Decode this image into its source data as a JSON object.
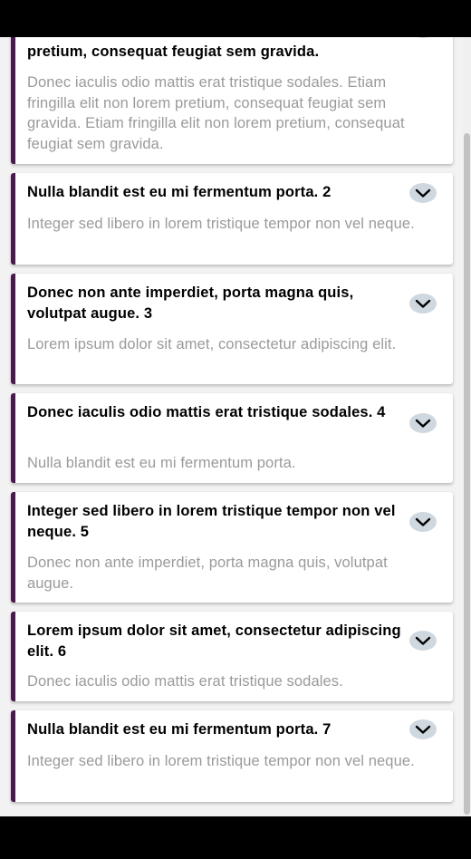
{
  "accordion": {
    "items": [
      {
        "title": "pretium, consequat feugiat sem gravida.",
        "body": "Donec iaculis odio mattis erat tristique sodales. Etiam fringilla elit non lorem pretium, consequat feugiat sem gravida. Etiam fringilla elit non lorem pretium, consequat feugiat sem gravida."
      },
      {
        "title": "Nulla blandit est eu mi fermentum porta. 2",
        "body": "Integer sed libero in lorem tristique tempor non vel neque."
      },
      {
        "title": "Donec non ante imperdiet, porta magna quis, volutpat augue. 3",
        "body": "Lorem ipsum dolor sit amet, consectetur adipiscing elit."
      },
      {
        "title": "Donec iaculis odio mattis erat tristique sodales. 4",
        "body": "Nulla blandit est eu mi fermentum porta."
      },
      {
        "title": "Integer sed libero in lorem tristique tempor non vel neque. 5",
        "body": "Donec non ante imperdiet, porta magna quis, volutpat augue."
      },
      {
        "title": "Lorem ipsum dolor sit amet, consectetur adipiscing elit. 6",
        "body": "Donec iaculis odio mattis erat tristique sodales."
      },
      {
        "title": "Nulla blandit est eu mi fermentum porta. 7",
        "body": "Integer sed libero in lorem tristique tempor non vel neque."
      }
    ],
    "toggle_icon": "chevron-down-icon",
    "colors": {
      "accent_border": "#4a1a4e",
      "toggle_bg": "#cfd8df",
      "body_text": "#9a9a9a"
    }
  }
}
